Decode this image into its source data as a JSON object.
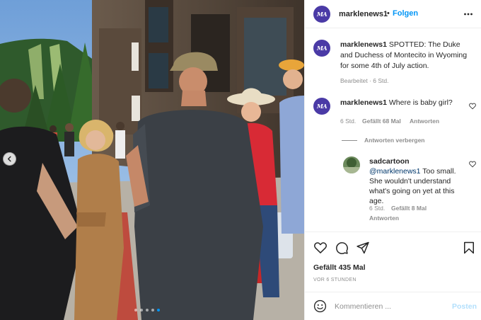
{
  "post": {
    "username": "marklenews1",
    "separator": "•",
    "follow_label": "Folgen",
    "avatar_text": "MA",
    "more_icon": "more-horizontal-icon",
    "image": {
      "description_icon": "photo",
      "nav_prev_icon": "chevron-left-icon",
      "carousel_dots": 5,
      "active_dot": 4,
      "accent": "#0095f6"
    }
  },
  "caption": {
    "username": "marklenews1",
    "text": "SPOTTED: The Duke and Duchess of Montecito in Wyoming for some 4th of July action.",
    "meta": "Bearbeitet · 6 Std."
  },
  "comments": [
    {
      "username": "marklenews1",
      "text": "Where is baby girl?",
      "time": "6 Std.",
      "likes_label": "Gefällt 68 Mal",
      "reply_label": "Antworten",
      "hide_replies_label": "Antworten verbergen",
      "replies": [
        {
          "username": "sadcartoon",
          "mention": "@marklenews1",
          "text": "Too small. She wouldn't understand what's going on yet at this age.",
          "time": "6 Std.",
          "likes_label": "Gefällt 8 Mal",
          "reply_label": "Antworten"
        }
      ]
    }
  ],
  "actions": {
    "like_icon": "heart-icon",
    "comment_icon": "comment-icon",
    "share_icon": "send-icon",
    "save_icon": "bookmark-icon",
    "likes_text": "Gefällt 435 Mal",
    "time_text": "VOR 6 STUNDEN"
  },
  "compose": {
    "emoji_icon": "emoji-icon",
    "placeholder": "Kommentieren ...",
    "post_label": "Posten"
  },
  "colors": {
    "link": "#0095f6",
    "text": "#262626",
    "secondary": "#8e8e8e",
    "avatar_bg": "#4a3aa6",
    "post_disabled": "#b2dffc"
  }
}
